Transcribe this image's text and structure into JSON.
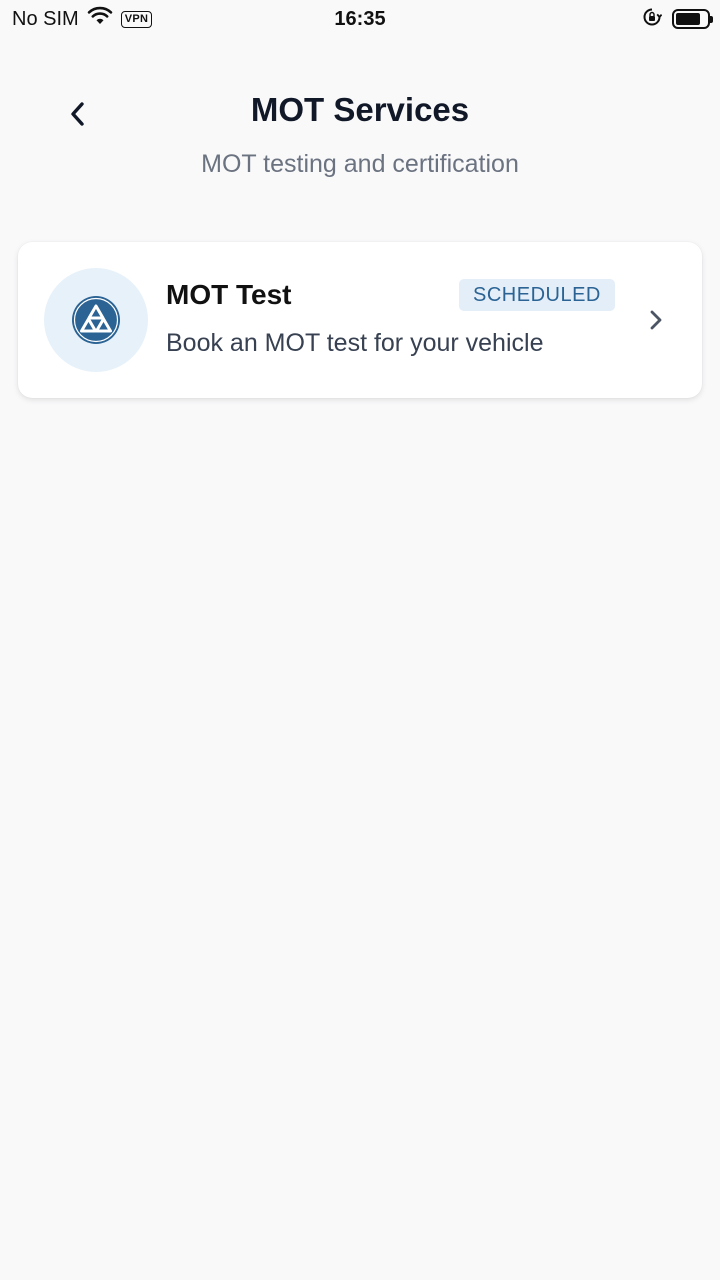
{
  "status_bar": {
    "carrier": "No SIM",
    "vpn": "VPN",
    "time": "16:35",
    "battery_level": 0.8
  },
  "header": {
    "title": "MOT Services",
    "subtitle": "MOT testing and certification"
  },
  "services": [
    {
      "title": "MOT Test",
      "badge": "SCHEDULED",
      "description": "Book an MOT test for your vehicle",
      "icon": "mot-triangles-icon"
    }
  ],
  "colors": {
    "accent": "#2a6394",
    "icon_bg": "#e7f1fa",
    "badge_bg": "#e3eef8",
    "background": "#f9f9fa"
  }
}
